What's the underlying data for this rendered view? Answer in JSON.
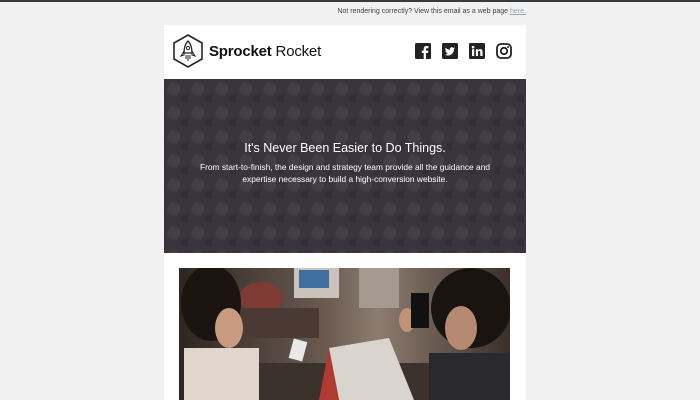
{
  "preheader": {
    "text": "Not rendering correctly? View this email as a web page",
    "link_label": "here."
  },
  "brand": {
    "name_bold": "Sprocket",
    "name_regular": " Rocket"
  },
  "social": [
    "facebook-icon",
    "twitter-icon",
    "linkedin-icon",
    "instagram-icon"
  ],
  "hero": {
    "title": "It's Never Been Easier to Do Things.",
    "body": "From start-to-finish, the design and strategy team provide all the guidance and expertise necessary to build a high-conversion website."
  },
  "colors": {
    "page_bg": "#f1f1f1",
    "hero_bg": "#39353f",
    "text_dark": "#111111"
  }
}
